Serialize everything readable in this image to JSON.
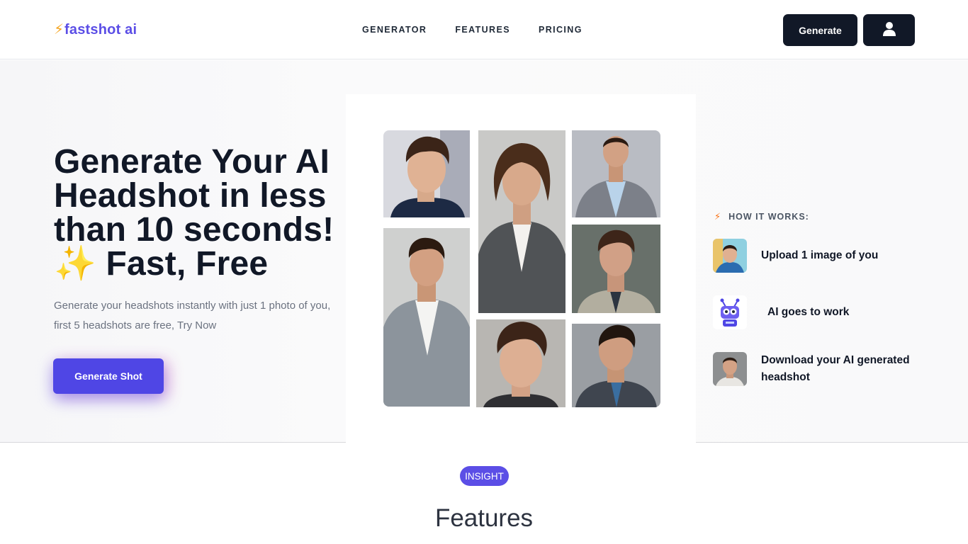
{
  "nav": {
    "logo_bolt": "⚡",
    "logo_text": "fastshot ai",
    "links": [
      "GENERATOR",
      "FEATURES",
      "PRICING"
    ],
    "generate_label": "Generate",
    "user_icon": "user-icon"
  },
  "hero": {
    "headline": "Generate Your AI Headshot in less than 10 seconds! ✨ Fast, Free",
    "subtext": "Generate your headshots instantly with just 1 photo of you, first 5 headshots are free, Try Now",
    "cta_label": "Generate Shot"
  },
  "how_it_works": {
    "title": "HOW IT WORKS:",
    "steps": [
      {
        "label": "Upload 1 image of you",
        "icon": "photo-thumbnail"
      },
      {
        "label": "AI goes to work",
        "icon": "robot-icon"
      },
      {
        "label": "Download your AI generated headshot",
        "icon": "headshot-thumbnail"
      }
    ]
  },
  "features": {
    "badge": "INSIGHT",
    "title": "Features"
  },
  "colors": {
    "brand": "#5b4ee6",
    "cta": "#4f46e5",
    "dark": "#111827",
    "accent_bolt": "#f5a623"
  }
}
